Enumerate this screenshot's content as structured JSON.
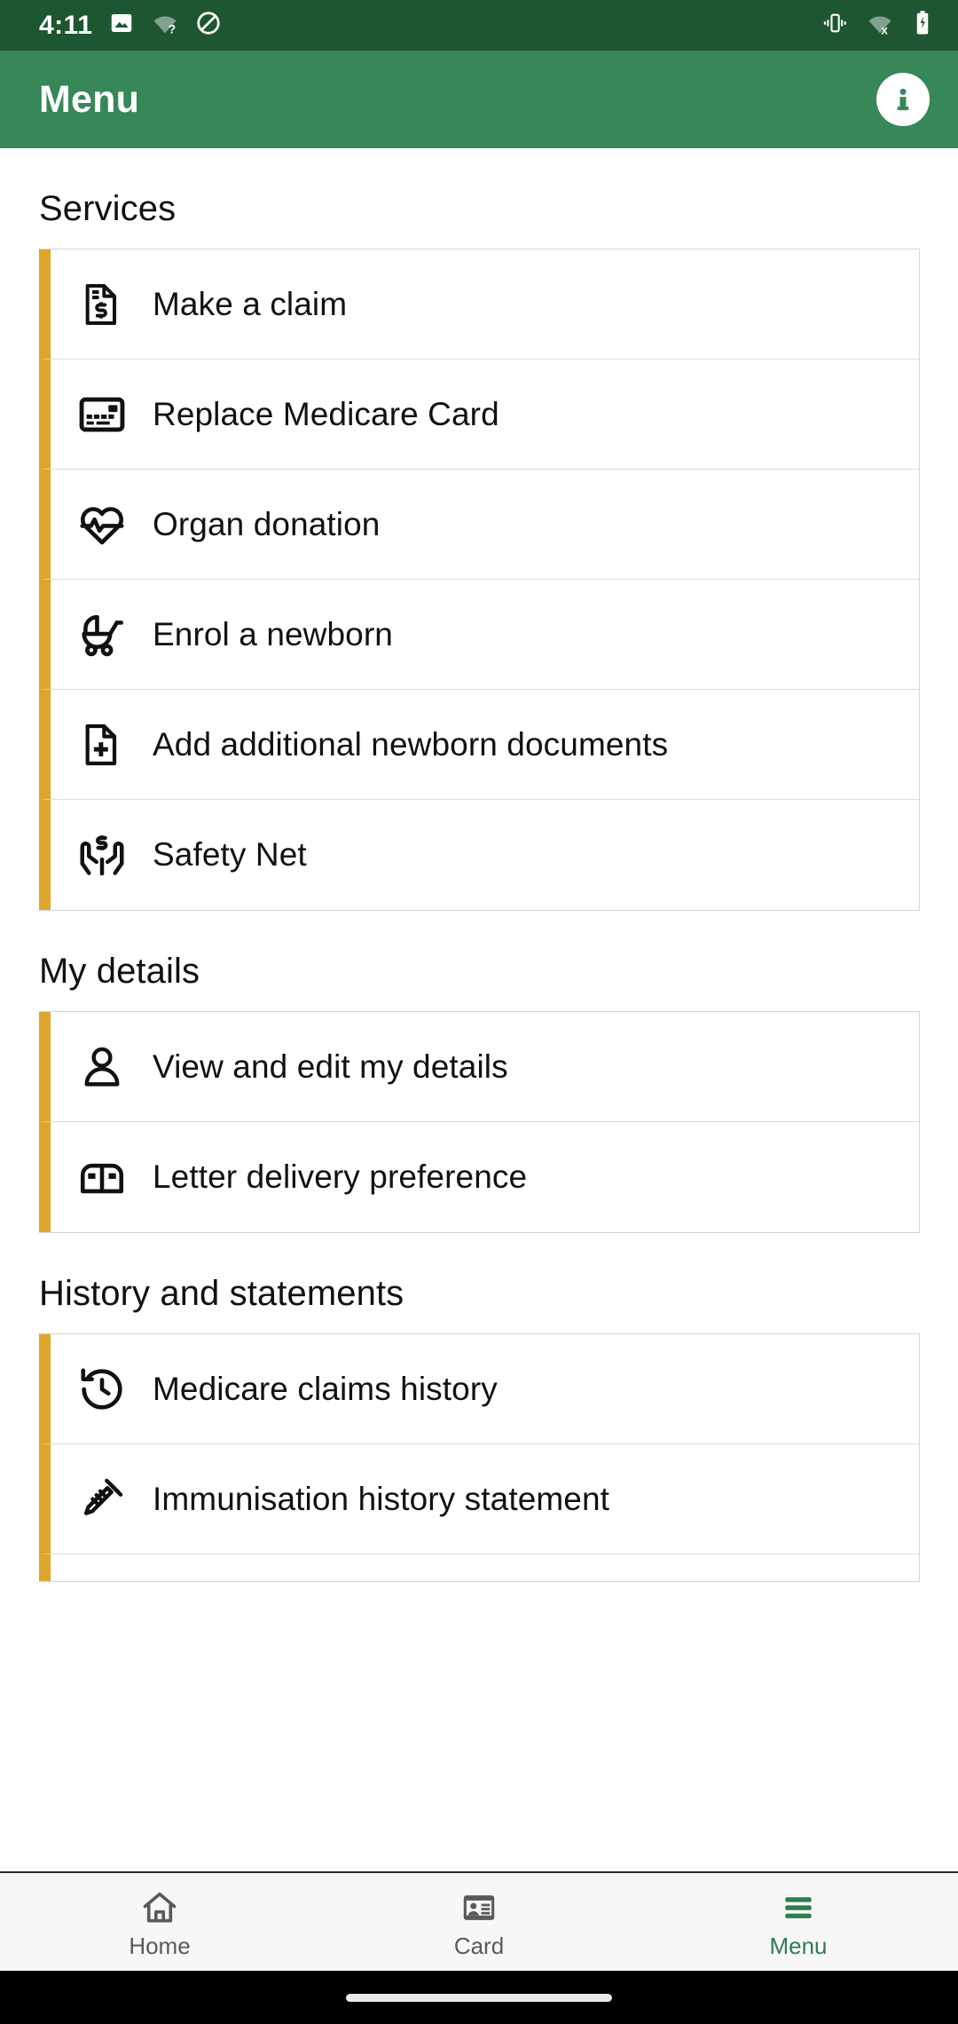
{
  "status_bar": {
    "time": "4:11",
    "left_icons": [
      "image-icon",
      "wifi-question-icon",
      "do-not-disturb-icon"
    ],
    "right_icons": [
      "vibrate-icon",
      "wifi-off-icon",
      "battery-charging-icon"
    ]
  },
  "app_bar": {
    "title": "Menu",
    "info_button_label": "i",
    "background_color": "#378759"
  },
  "theme": {
    "status_bar_color": "#1E5631",
    "app_bar_color": "#378759",
    "accent_gold": "#E0A42B",
    "active_nav_color": "#2E7D4F",
    "card_border": "#d6d6d6"
  },
  "sections": [
    {
      "title": "Services",
      "items": [
        {
          "label": "Make a claim",
          "icon": "document-dollar-icon"
        },
        {
          "label": "Replace Medicare Card",
          "icon": "id-card-icon"
        },
        {
          "label": "Organ donation",
          "icon": "heart-pulse-icon"
        },
        {
          "label": "Enrol a newborn",
          "icon": "stroller-icon"
        },
        {
          "label": "Add additional newborn documents",
          "icon": "document-plus-icon"
        },
        {
          "label": "Safety Net",
          "icon": "hands-dollar-icon"
        }
      ]
    },
    {
      "title": "My details",
      "items": [
        {
          "label": "View and edit my details",
          "icon": "person-icon"
        },
        {
          "label": "Letter delivery preference",
          "icon": "mailbox-icon"
        }
      ]
    },
    {
      "title": "History and statements",
      "items": [
        {
          "label": "Medicare claims history",
          "icon": "history-clock-icon"
        },
        {
          "label": "Immunisation history statement",
          "icon": "syringe-icon"
        }
      ]
    }
  ],
  "bottom_nav": {
    "items": [
      {
        "label": "Home",
        "icon": "home-icon",
        "active": false
      },
      {
        "label": "Card",
        "icon": "card-icon",
        "active": false
      },
      {
        "label": "Menu",
        "icon": "hamburger-icon",
        "active": true
      }
    ]
  }
}
